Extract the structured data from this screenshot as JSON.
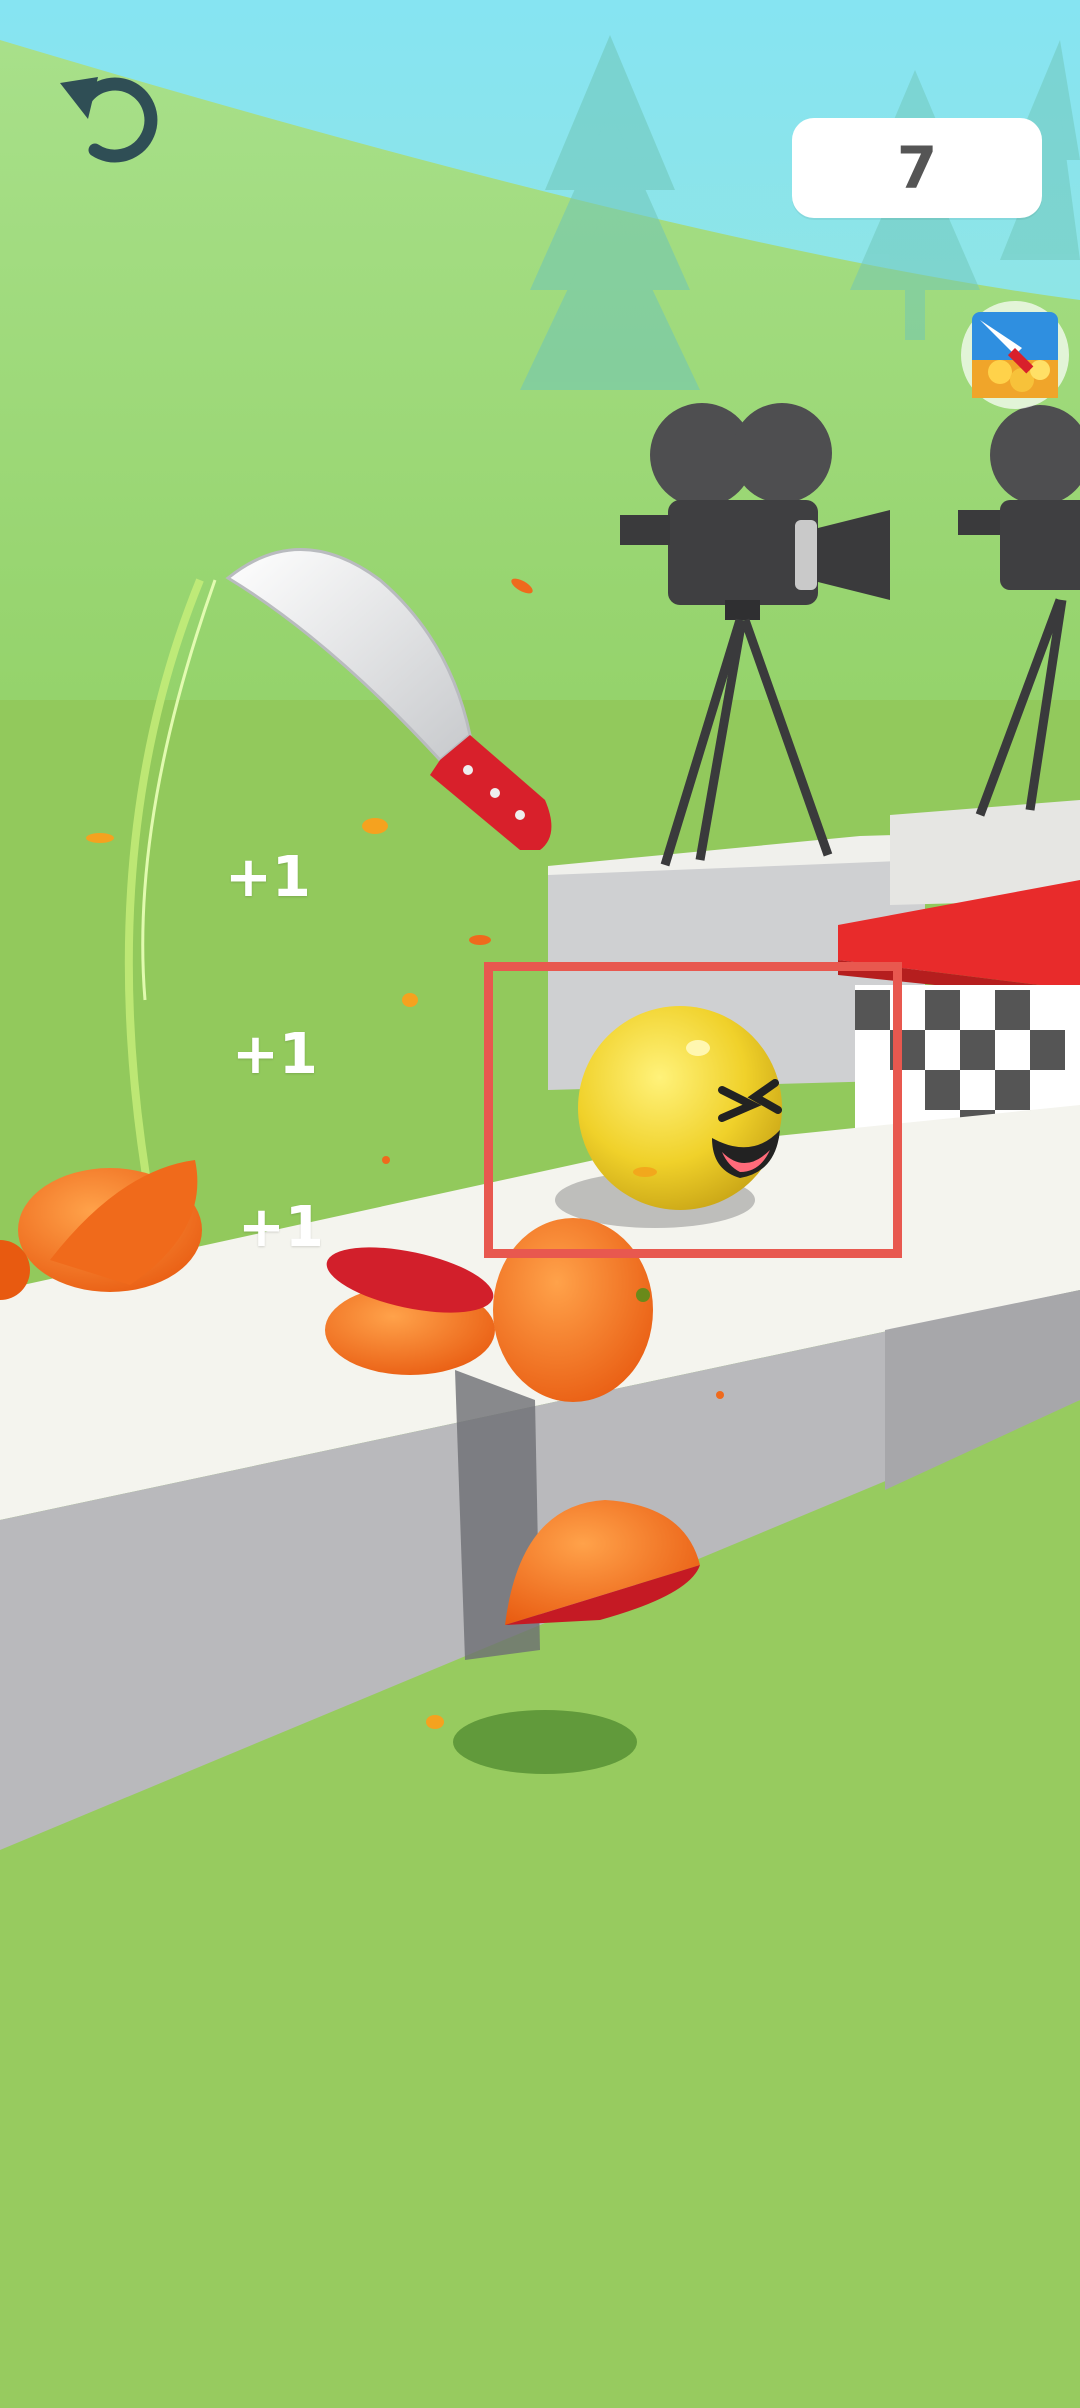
{
  "hud": {
    "score": "7",
    "restart_icon": "undo-arrow-icon",
    "app_badge_icon": "knife-game-app-icon"
  },
  "floating_texts": [
    "+1",
    "+1",
    "+1"
  ],
  "colors": {
    "sky": "#7fdff0",
    "grass": "#8fc95a",
    "track_top": "#f4f4ee",
    "track_side": "#b9b9bc",
    "knife_handle": "#d8202b",
    "target_ball": "#f2d52a",
    "highlight_box": "#e8584f"
  }
}
